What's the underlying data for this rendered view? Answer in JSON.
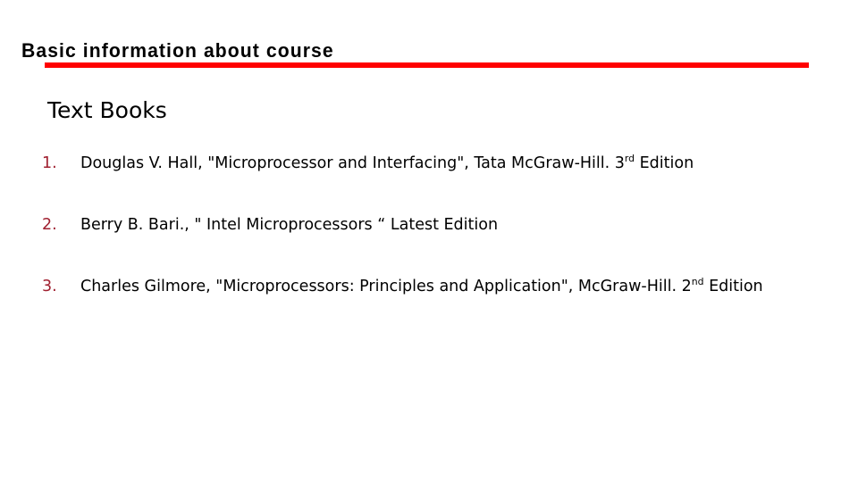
{
  "slide": {
    "title": "Basic information about course",
    "accent_color": "#ff0000",
    "number_color": "#a02030",
    "text_color": "#000000",
    "background_color": "#ffffff",
    "section_heading": "Text Books",
    "books": [
      {
        "number": "1.",
        "text_before_sup": "Douglas V. Hall, \"Microprocessor and Interfacing\", Tata McGraw-Hill. 3",
        "sup": "rd",
        "text_after_sup": " Edition"
      },
      {
        "number": "2.",
        "text_before_sup": "Berry B. Bari., \" Intel Microprocessors “ Latest Edition",
        "sup": "",
        "text_after_sup": ""
      },
      {
        "number": "3.",
        "text_before_sup": "Charles Gilmore, \"Microprocessors: Principles and Application\", McGraw-Hill. 2",
        "sup": "nd",
        "text_after_sup": " Edition"
      }
    ]
  }
}
